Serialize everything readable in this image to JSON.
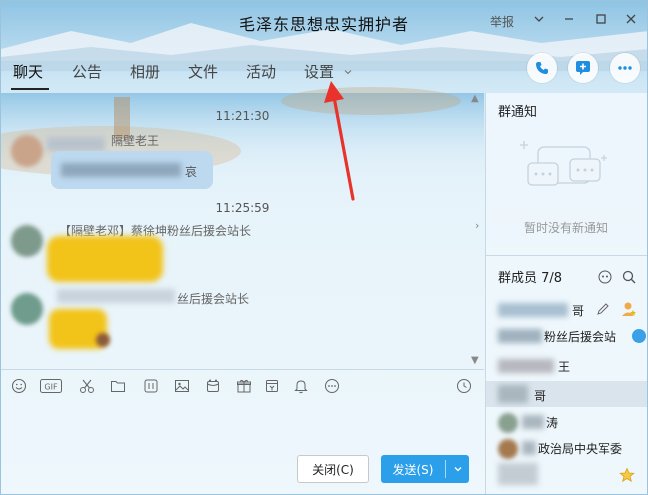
{
  "window": {
    "title": "毛泽东思想忠实拥护者",
    "report_label": "举报"
  },
  "tabs": [
    {
      "label": "聊天",
      "active": true
    },
    {
      "label": "公告"
    },
    {
      "label": "相册"
    },
    {
      "label": "文件"
    },
    {
      "label": "活动"
    },
    {
      "label": "设置"
    }
  ],
  "header_actions": [
    "phone-icon",
    "add-share-icon",
    "more-icon"
  ],
  "chat": {
    "messages": [
      {
        "time": "11:21:30",
        "sender": "隔壁老王",
        "tail_char": "哀"
      },
      {
        "time": "11:25:59",
        "sender": "【隔壁老邓】蔡徐坤粉丝后援会站长"
      },
      {
        "sender": "丝后援会站长"
      }
    ]
  },
  "toolbar_icons": [
    "emoji-icon",
    "gif-icon",
    "scissors-icon",
    "folder-icon",
    "sticker-icon",
    "image-icon",
    "red-packet-icon",
    "gift-icon",
    "shop-icon",
    "bell-icon",
    "more-circle-icon",
    "history-clock-icon"
  ],
  "buttons": {
    "close": "关闭(C)",
    "send": "发送(S)"
  },
  "right_panel": {
    "notice_title": "群通知",
    "no_notice_text": "暂时没有新通知",
    "members_title": "群成员 7/8",
    "members": [
      {
        "name_tail": "哥"
      },
      {
        "name_tail": "粉丝后援会站"
      },
      {
        "name_tail": "王"
      },
      {
        "name_tail": "哥"
      },
      {
        "name_tail": "涛"
      },
      {
        "name_tail": "政治局中央军委"
      },
      {
        "name_tail": ""
      }
    ]
  },
  "colors": {
    "accent": "#2c9fea",
    "annotation_red": "#e8322b",
    "bubble_blue": "#cfe3f4",
    "blur_yellow": "#f2c318"
  }
}
